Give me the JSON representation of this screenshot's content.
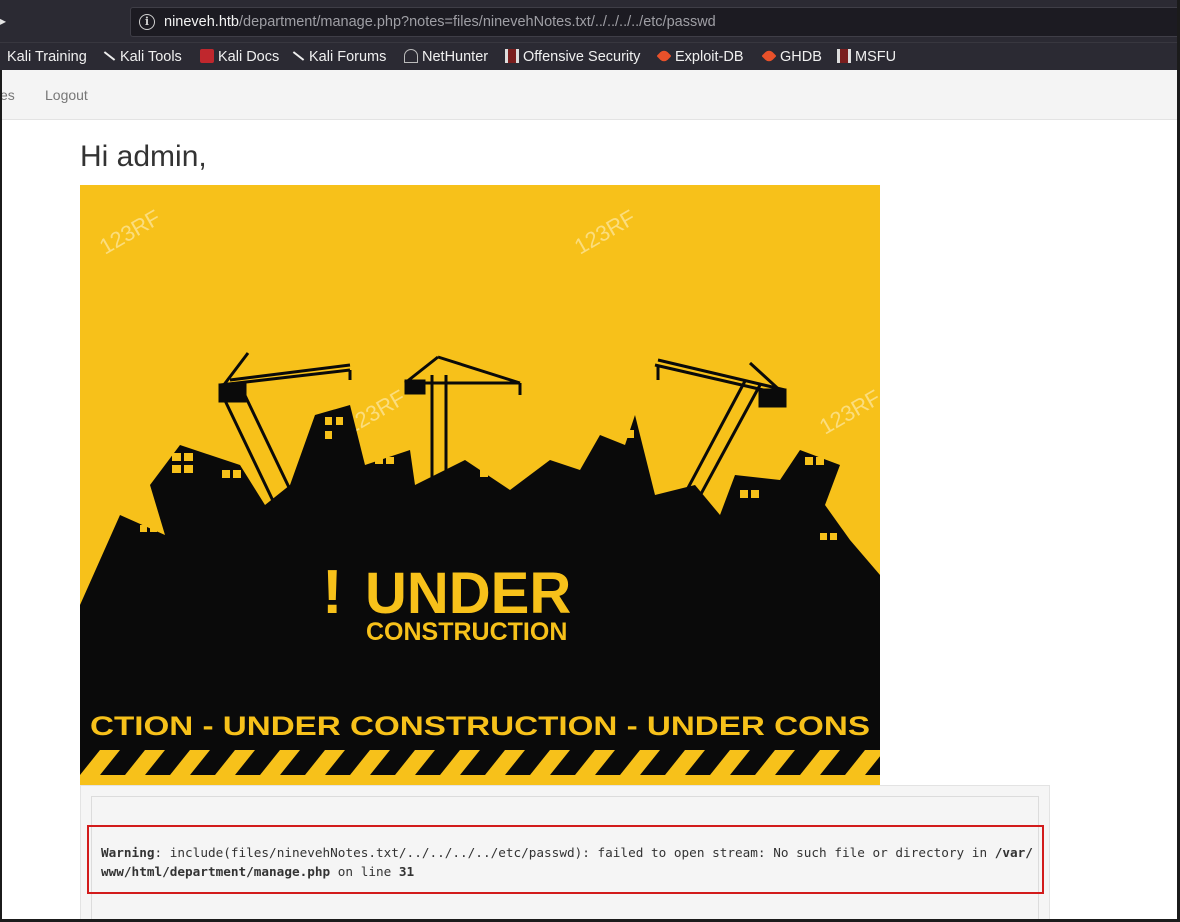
{
  "browser": {
    "url_host": "nineveh.htb",
    "url_path": "/department/manage.php?notes=files/ninevehNotes.txt/../../../../etc/passwd",
    "bookmarks": [
      {
        "label": "Kali Training",
        "icon": "kali-dragon-icon"
      },
      {
        "label": "Kali Tools",
        "icon": "kali-dragon-icon"
      },
      {
        "label": "Kali Docs",
        "icon": "kali-docs-icon"
      },
      {
        "label": "Kali Forums",
        "icon": "kali-dragon-icon"
      },
      {
        "label": "NetHunter",
        "icon": "nethunter-icon"
      },
      {
        "label": "Offensive Security",
        "icon": "offsec-icon"
      },
      {
        "label": "Exploit-DB",
        "icon": "exploitdb-icon"
      },
      {
        "label": "GHDB",
        "icon": "exploitdb-icon"
      },
      {
        "label": "MSFU",
        "icon": "offsec-icon"
      }
    ]
  },
  "navbar": {
    "partial_item": "es",
    "logout": "Logout"
  },
  "page": {
    "greeting": "Hi admin,",
    "banner": {
      "exclaim": "!",
      "title": "UNDER",
      "subtitle": "CONSTRUCTION",
      "tape_text": "CTION - UNDER  CONSTRUCTION - UNDER  CONS",
      "watermark": "123RF",
      "colors": {
        "yellow": "#f7c11a",
        "black": "#0a0a0a"
      }
    },
    "warning": {
      "label": "Warning",
      "message": ":  include(files/ninevehNotes.txt/../../../../etc/passwd): failed to open stream: No such file or directory in ",
      "path": "/var/www/html/department/manage.php",
      "on_line": " on line ",
      "line": "31"
    },
    "highlight_color": "#d21b1b"
  }
}
